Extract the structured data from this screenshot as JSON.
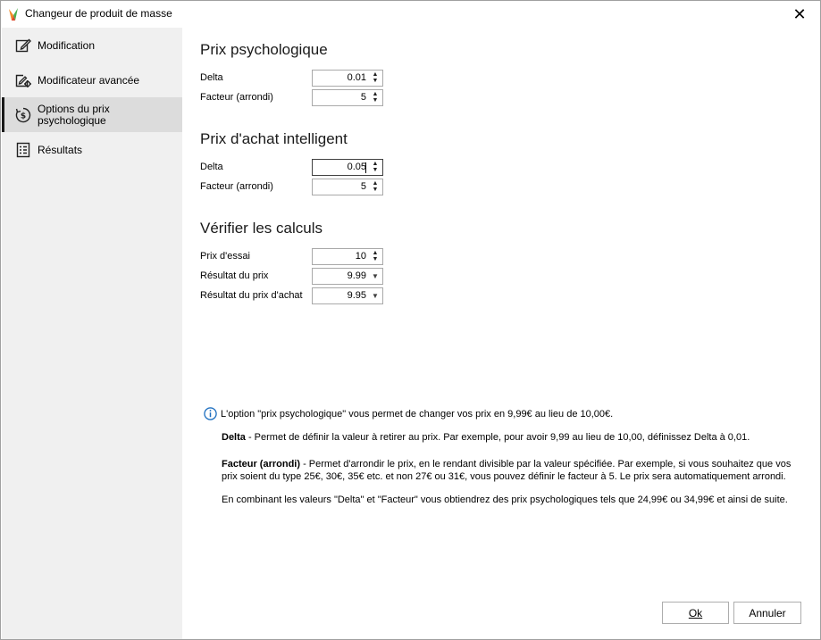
{
  "window": {
    "title": "Changeur de produit de masse",
    "close_glyph": "✕"
  },
  "sidebar": {
    "items": [
      {
        "label": "Modification",
        "icon": "edit-icon",
        "active": false
      },
      {
        "label": "Modificateur avancée",
        "icon": "advanced-edit-icon",
        "active": false
      },
      {
        "label": "Options du prix psychologique",
        "icon": "price-options-icon",
        "active": true
      },
      {
        "label": "Résultats",
        "icon": "results-icon",
        "active": false
      }
    ]
  },
  "sections": {
    "psych": {
      "title": "Prix psychologique",
      "delta_label": "Delta",
      "delta_value": "0.01",
      "facteur_label": "Facteur (arrondi)",
      "facteur_value": "5"
    },
    "smart": {
      "title": "Prix d'achat intelligent",
      "delta_label": "Delta",
      "delta_value": "0.05",
      "facteur_label": "Facteur (arrondi)",
      "facteur_value": "5"
    },
    "verify": {
      "title": "Vérifier les calculs",
      "essai_label": "Prix d'essai",
      "essai_value": "10",
      "resultat_label": "Résultat du prix",
      "resultat_value": "9.99",
      "achat_label": "Résultat du prix d'achat",
      "achat_value": "9.95"
    }
  },
  "info": {
    "intro": "L'option \"prix psychologique\" vous permet de changer vos prix en 9,99€ au lieu de 10,00€.",
    "delta_term": "Delta",
    "delta_text": " - Permet de définir la valeur à retirer au prix. Par exemple, pour avoir 9,99 au lieu de 10,00, définissez Delta à 0,01.",
    "facteur_term": "Facteur (arrondi)",
    "facteur_text": " - Permet d'arrondir le prix, en le rendant divisible par la valeur spécifiée. Par exemple, si vous souhaitez que vos prix soient du type 25€, 30€, 35€ etc. et non 27€ ou 31€, vous pouvez définir le facteur à 5. Le prix sera automatiquement arrondi.",
    "combine_text": "En combinant les valeurs \"Delta\" et \"Facteur\" vous obtiendrez des prix psychologiques tels que 24,99€ ou 34,99€ et ainsi de suite."
  },
  "buttons": {
    "ok_label": "Ok",
    "cancel_label": "Annuler"
  },
  "colors": {
    "sidebar_bg": "#f0f0f0",
    "active_item_bg": "#dcdcdc",
    "info_icon": "#1e6fc0",
    "logo_orange": "#f28c28",
    "logo_green": "#4caf50"
  }
}
